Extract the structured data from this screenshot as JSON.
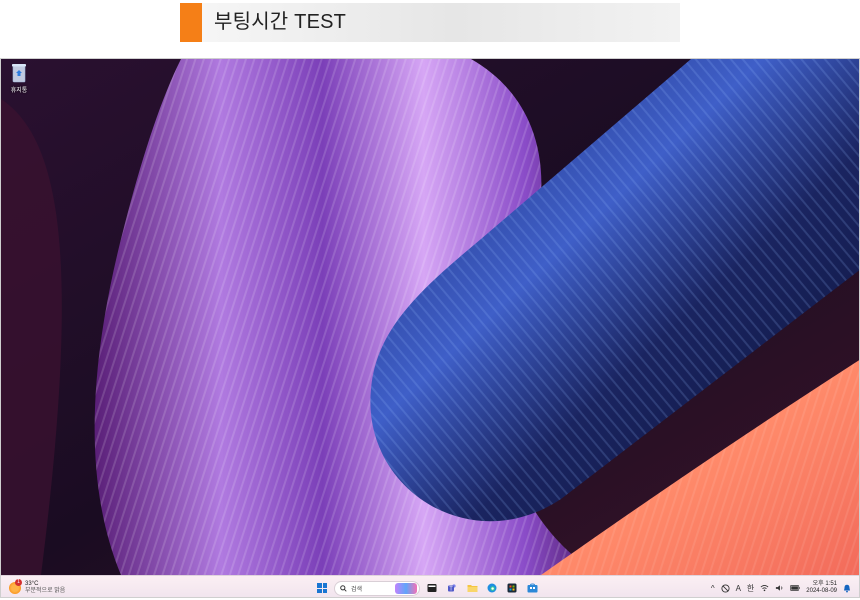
{
  "header": {
    "title": "부팅시간 TEST"
  },
  "desktop": {
    "icons": [
      {
        "label": "휴지통",
        "icon": "recycle-bin-icon"
      }
    ]
  },
  "taskbar": {
    "weather": {
      "temp": "33°C",
      "desc": "부분적으로 맑음",
      "alert_count": "1"
    },
    "search_placeholder": "검색",
    "pinned": [
      "file-explorer-icon",
      "teams-icon",
      "folder-icon",
      "edge-icon",
      "store-icon",
      "ms-store-icon"
    ],
    "tray": {
      "ime_a": "A",
      "ime_kor": "한"
    },
    "clock": {
      "time": "오후 1:51",
      "date": "2024-08-09"
    }
  }
}
